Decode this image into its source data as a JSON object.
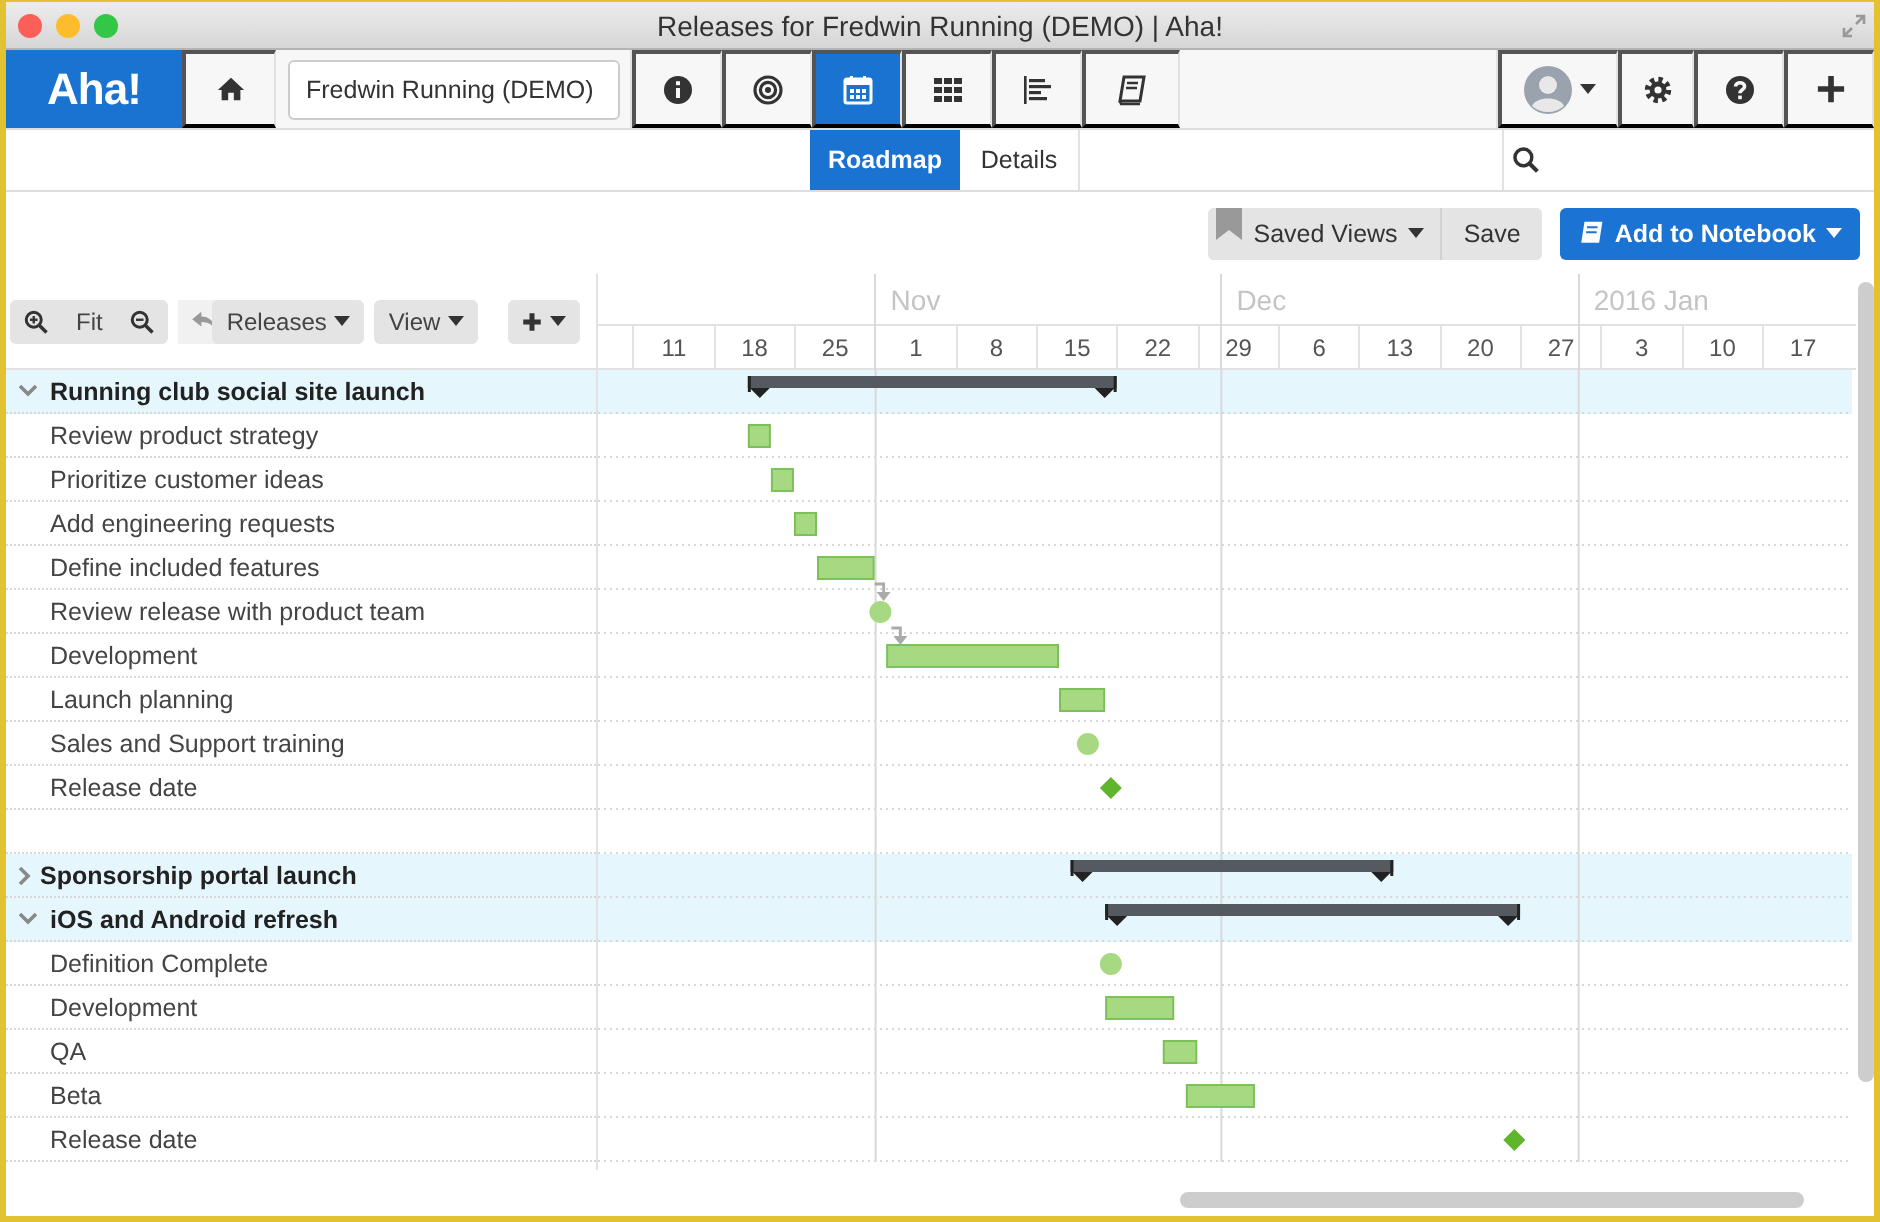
{
  "window": {
    "title": "Releases for Fredwin Running (DEMO) | Aha!"
  },
  "nav": {
    "logo": "Aha!",
    "product": "Fredwin Running (DEMO)",
    "tabs": [
      {
        "kind": "info",
        "selected": false
      },
      {
        "kind": "target",
        "selected": false
      },
      {
        "kind": "calendar",
        "selected": true
      },
      {
        "kind": "grid",
        "selected": false
      },
      {
        "kind": "list",
        "selected": false
      },
      {
        "kind": "notebook",
        "selected": false
      }
    ]
  },
  "subtabs": [
    {
      "label": "Roadmap",
      "selected": true
    },
    {
      "label": "Details",
      "selected": false
    }
  ],
  "toolbar": {
    "saved_views": "Saved Views",
    "save": "Save",
    "add_to_notebook": "Add to Notebook"
  },
  "gantt": {
    "controls": {
      "fit": "Fit",
      "releases": "Releases",
      "view": "View"
    },
    "months": [
      "Nov",
      "Dec",
      "2016 Jan"
    ],
    "weeks": [
      "11",
      "18",
      "25",
      "1",
      "8",
      "15",
      "22",
      "29",
      "6",
      "13",
      "20",
      "27",
      "3",
      "10",
      "17"
    ],
    "rows": [
      {
        "name": "Running club social site launch",
        "kind": "release",
        "expanded": true,
        "children": [
          {
            "name": "Review product strategy",
            "kind": "bar"
          },
          {
            "name": "Prioritize customer ideas",
            "kind": "bar"
          },
          {
            "name": "Add engineering requests",
            "kind": "bar"
          },
          {
            "name": "Define included features",
            "kind": "bar"
          },
          {
            "name": "Review release with product team",
            "kind": "milestone",
            "dependency": true
          },
          {
            "name": "Development",
            "kind": "bar",
            "dependency": true
          },
          {
            "name": "Launch planning",
            "kind": "bar"
          },
          {
            "name": "Sales and Support training",
            "kind": "milestone"
          },
          {
            "name": "Release date",
            "kind": "release_date"
          },
          {
            "kind": "spacer"
          }
        ]
      },
      {
        "name": "Sponsorship portal launch",
        "kind": "release",
        "expanded": false
      },
      {
        "name": "iOS and Android refresh",
        "kind": "release",
        "expanded": true,
        "children": [
          {
            "name": "Definition Complete",
            "kind": "milestone"
          },
          {
            "name": "Development",
            "kind": "bar"
          },
          {
            "name": "QA",
            "kind": "bar"
          },
          {
            "name": "Beta",
            "kind": "bar"
          },
          {
            "name": "Release date",
            "kind": "release_date"
          }
        ]
      }
    ]
  }
}
